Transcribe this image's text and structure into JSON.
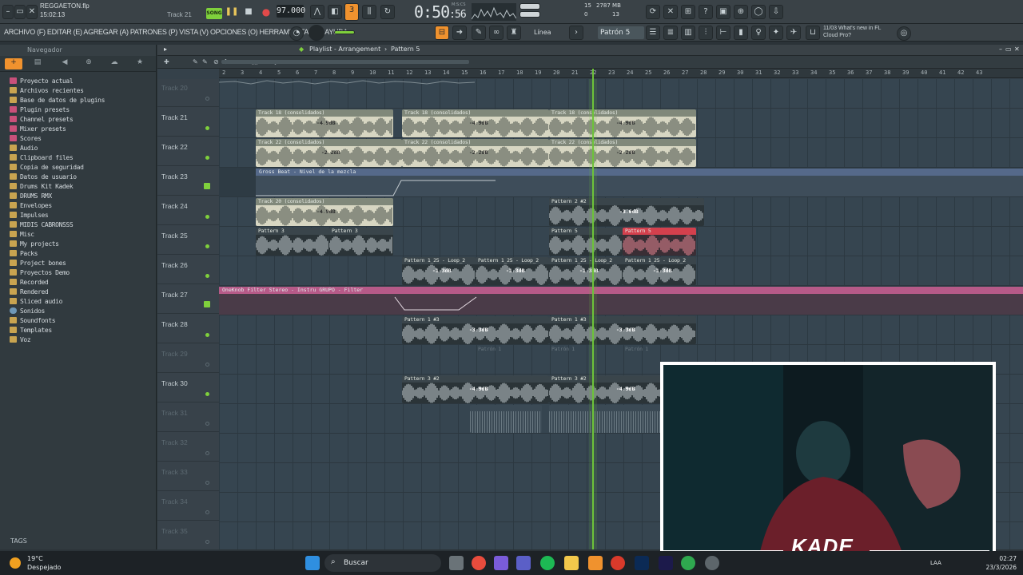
{
  "window": {
    "file_name": "REGGAETON.flp",
    "clock_small": "15:02:13",
    "track_indicator": "Track 21",
    "song_label": "SONG",
    "tempo": "97.000",
    "time": "0:50",
    "time_frac": ":56",
    "time_unit": "M:S:CS",
    "cpu_num_top": "15",
    "cpu_num_bottom": "0",
    "mem_top": "2787 MB",
    "mem_bottom": "13"
  },
  "menu": {
    "text": "ARCHIVO (F) EDITAR (E) AGREGAR (A) PATRONES (P) VISTA (V) OPCIONES (O) HERRAMIENTAS (T) AYUDA",
    "snap": "Línea",
    "pattern_selector": "Patrón 5",
    "news_line1": "11/03  What's new in FL",
    "news_line2": "Cloud Pro?"
  },
  "browser": {
    "title": "Navegador",
    "items": [
      {
        "label": "Proyecto actual",
        "icon": "pink"
      },
      {
        "label": "Archivos recientes",
        "icon": "folder"
      },
      {
        "label": "Base de datos de plugins",
        "icon": "folder"
      },
      {
        "label": "Plugin presets",
        "icon": "pink"
      },
      {
        "label": "Channel presets",
        "icon": "pink"
      },
      {
        "label": "Mixer presets",
        "icon": "pink"
      },
      {
        "label": "Scores",
        "icon": "pink"
      },
      {
        "label": "Audio",
        "icon": "folder"
      },
      {
        "label": "Clipboard files",
        "icon": "folder"
      },
      {
        "label": "Copia de seguridad",
        "icon": "folder"
      },
      {
        "label": "Datos de usuario",
        "icon": "folder"
      },
      {
        "label": "Drums Kit Kadek",
        "icon": "folder"
      },
      {
        "label": "DRUMS RMX",
        "icon": "folder"
      },
      {
        "label": "Envelopes",
        "icon": "folder"
      },
      {
        "label": "Impulses",
        "icon": "folder"
      },
      {
        "label": "MIDIS CABRONSSS",
        "icon": "folder"
      },
      {
        "label": "Misc",
        "icon": "folder"
      },
      {
        "label": "My projects",
        "icon": "folder"
      },
      {
        "label": "Packs",
        "icon": "folder"
      },
      {
        "label": "Project bones",
        "icon": "folder"
      },
      {
        "label": "Proyectos Demo",
        "icon": "folder"
      },
      {
        "label": "Recorded",
        "icon": "folder"
      },
      {
        "label": "Rendered",
        "icon": "folder"
      },
      {
        "label": "Sliced audio",
        "icon": "folder"
      },
      {
        "label": "Sonidos",
        "icon": "cloud"
      },
      {
        "label": "Soundfonts",
        "icon": "folder"
      },
      {
        "label": "Templates",
        "icon": "folder"
      },
      {
        "label": "Voz",
        "icon": "folder"
      }
    ],
    "tags_label": "TAGS"
  },
  "playlist": {
    "title": "Playlist - Arrangement",
    "sep": "›",
    "pattern": "Pattern 5",
    "ruler": [
      "2",
      "3",
      "4",
      "5",
      "6",
      "7",
      "8",
      "9",
      "10",
      "11",
      "12",
      "13",
      "14",
      "15",
      "16",
      "17",
      "18",
      "19",
      "20",
      "21",
      "22",
      "23",
      "24",
      "25",
      "26",
      "27",
      "28",
      "29",
      "30",
      "31",
      "32",
      "33",
      "34",
      "35",
      "36",
      "37",
      "38",
      "39",
      "40",
      "41",
      "42",
      "43"
    ],
    "tracks": [
      {
        "name": "Track 20",
        "dim": true
      },
      {
        "name": "Track 21"
      },
      {
        "name": "Track 22"
      },
      {
        "name": "Track 23",
        "lock": true
      },
      {
        "name": "Track 24"
      },
      {
        "name": "Track 25"
      },
      {
        "name": "Track 26"
      },
      {
        "name": "Track 27",
        "lock": true
      },
      {
        "name": "Track 28"
      },
      {
        "name": "Track 29",
        "dim": true
      },
      {
        "name": "Track 30"
      },
      {
        "name": "Track 31",
        "dim": true
      },
      {
        "name": "Track 32",
        "dim": true
      },
      {
        "name": "Track 33",
        "dim": true
      },
      {
        "name": "Track 34",
        "dim": true
      },
      {
        "name": "Track 35",
        "dim": true
      }
    ],
    "clips": {
      "t21": [
        "Track 18 (consolidados)",
        "Track 18 (consolidados)",
        "Track 18 (consolidados)"
      ],
      "t21_gain": "-4.9dB",
      "t22": [
        "Track 22 (consolidados)",
        "Track 22 (consolidados)",
        "Track 22 (consolidados)"
      ],
      "t22_gain": "-2.2dB",
      "t23_auto": "Gross Beat - Nivel de la mezcla",
      "t24a": "Track 20 (consolidados)",
      "t24b": "Pattern 2 #2",
      "t24b_gain": "-3.6dB",
      "t25a": "Pattern 3",
      "t25b": "Pattern 3",
      "t25c": "Pattern 5",
      "t25d": "Pattern 5",
      "t26": [
        "Pattern 1_25 - Loop_2",
        "Pattern 1_25 - Loop_2",
        "Pattern 1_25 - Loop_2",
        "Pattern 1_25 - Loop_2"
      ],
      "t26_gain": "-1.3dB",
      "t27_auto": "OneKnob Filter Stereo - Instru GRUPO - Filter",
      "t28a": "Pattern 1 #3",
      "t28b": "Pattern 1 #3",
      "t28_gain": "-3.3dB",
      "t29": [
        "Patrón 1",
        "Patrón 1",
        "Patrón 1"
      ],
      "t30a": "Pattern 3 #2",
      "t30b": "Pattern 3 #2",
      "t30_gain": "-4.9dB"
    }
  },
  "webcam": {
    "name": "KADE"
  },
  "taskbar": {
    "temp": "19°C",
    "weather": "Despejado",
    "search": "Buscar",
    "lang": "LAA",
    "time": "02:27",
    "date": "23/3/2026"
  }
}
